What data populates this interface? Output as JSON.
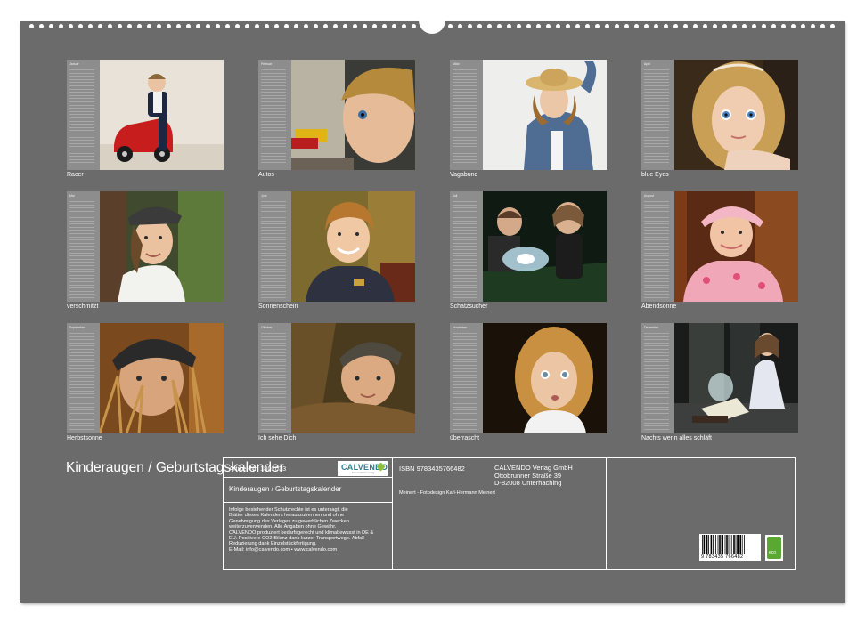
{
  "calendar_title": "Kinderaugen / Geburtstagskalender",
  "colors": {
    "board": "#6b6b6b",
    "strip": "#8d8d8d",
    "text": "#ffffff",
    "publisher_accent": "#2f7e8f",
    "eco_green": "#5aa832"
  },
  "months": [
    {
      "name": "Januar",
      "caption": "Racer"
    },
    {
      "name": "Februar",
      "caption": "Autos"
    },
    {
      "name": "März",
      "caption": "Vagabund"
    },
    {
      "name": "April",
      "caption": "blue Eyes"
    },
    {
      "name": "Mai",
      "caption": "verschmitzt"
    },
    {
      "name": "Juni",
      "caption": "Sonnenschein"
    },
    {
      "name": "Juli",
      "caption": "Schatzsucher"
    },
    {
      "name": "August",
      "caption": "Abendsonne"
    },
    {
      "name": "September",
      "caption": "Herbstsonne"
    },
    {
      "name": "Oktober",
      "caption": "Ich sehe Dich"
    },
    {
      "name": "November",
      "caption": "überrascht"
    },
    {
      "name": "Dezember",
      "caption": "Nachts wenn alles schläft"
    }
  ],
  "info": {
    "article_no": "Artikel-Nr. 1802033",
    "product_title": "Kinderaugen / Geburtstagskalender",
    "notice": [
      "Infolge bestehender Schutzrechte ist es untersagt, die",
      "Blätter dieses Kalenders herauszutrennen und ohne",
      "Genehmigung des Verlages zu gewerblichen Zwecken",
      "weiterzuverwenden. Alle Angaben ohne Gewähr.",
      "CALVENDO produziert bedarfsgerecht und klimabewusst in DE &",
      "EU. Positivere CO2-Bilanz dank kurzer Transportwege. Abfall-",
      "Reduzierung dank Einzelstückfertigung.",
      "E-Mail: info@calvendo.com • www.calvendo.com"
    ],
    "isbn": "ISBN 9783435766482",
    "publisher": [
      "CALVENDO Verlag GmbH",
      "Ottobrunner Straße 39",
      "D-82008 Unterhaching"
    ],
    "author": "Meinert - Fotodesign Karl-Hermann Meinert",
    "logo_text": "CALVENDO",
    "logo_subtext": "Dein Kalenderverlag",
    "barcode_number": "9 783435 766482",
    "eco_label": "eco"
  }
}
